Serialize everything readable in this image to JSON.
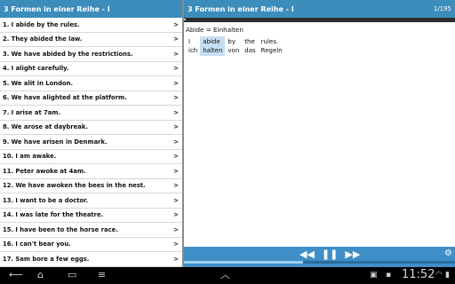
{
  "left": {
    "title": "3 Formen in einer Reihe - I",
    "items": [
      {
        "label": "1. I abide by the rules.",
        "chevron": ">"
      },
      {
        "label": "2. They abided the law.",
        "chevron": ">"
      },
      {
        "label": "3. We have abided by the restrictions.",
        "chevron": ">"
      },
      {
        "label": "4. I alight carefully.",
        "chevron": ">"
      },
      {
        "label": "5. We alit in London.",
        "chevron": ">"
      },
      {
        "label": "6. We have alighted at the platform.",
        "chevron": ">"
      },
      {
        "label": "7. I arise at 7am.",
        "chevron": ">"
      },
      {
        "label": "8. We arose at daybreak.",
        "chevron": ">"
      },
      {
        "label": "9. We have arisen in Denmark.",
        "chevron": ">"
      },
      {
        "label": "10. I am awake.",
        "chevron": ">"
      },
      {
        "label": "11. Peter awoke at 4am.",
        "chevron": ">"
      },
      {
        "label": "12. We have awoken the bees in the nest.",
        "chevron": ">"
      },
      {
        "label": "13. I want to be a doctor.",
        "chevron": ">"
      },
      {
        "label": "14. I was late for the theatre.",
        "chevron": ">"
      },
      {
        "label": "15. I have been to the horse race.",
        "chevron": ">"
      },
      {
        "label": "16. I can't bear you.",
        "chevron": ">"
      },
      {
        "label": "17. Sam bore a few eggs.",
        "chevron": ">"
      }
    ]
  },
  "right": {
    "title": "3 Formen in einer Reihe - I",
    "counter": "1/195",
    "progress": 0.005,
    "translation": "Abide = Einhalten",
    "words": [
      {
        "en": "I",
        "de": "ich",
        "highlight": false
      },
      {
        "en": "abide",
        "de": "halten",
        "highlight": true
      },
      {
        "en": "by",
        "de": "von",
        "highlight": false
      },
      {
        "en": "the",
        "de": "das",
        "highlight": false
      },
      {
        "en": "rules.",
        "de": "Regeln",
        "highlight": false
      }
    ],
    "player": {
      "rewind": "◀◀",
      "pause": "❚❚",
      "forward": "▶▶",
      "settings_icon": "gear-icon",
      "progress": 0.44
    }
  },
  "system": {
    "clock": "11:52",
    "back_icon": "back-arrow-icon",
    "home_icon": "home-icon",
    "recent_icon": "recent-apps-icon",
    "menu_icon": "menu-icon"
  },
  "colors": {
    "accent": "#3c8dbc",
    "highlight": "#c7dff2",
    "player": "#3f8ec7"
  }
}
